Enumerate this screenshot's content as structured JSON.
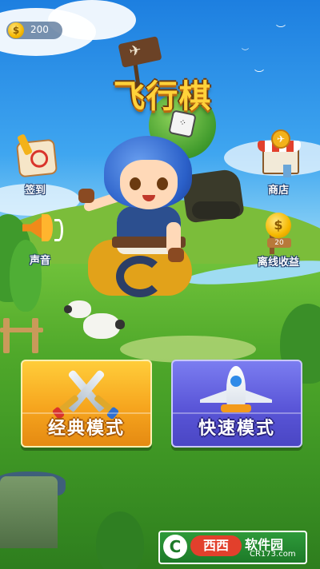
{
  "currency": {
    "coins": "200",
    "icon": "coin-icon"
  },
  "logo": {
    "title": "飞行棋"
  },
  "side_menu": {
    "checkin": {
      "label": "签到",
      "icon": "checkin-calendar-icon"
    },
    "sound": {
      "label": "声音",
      "icon": "speaker-horn-icon"
    },
    "shop": {
      "label": "商店",
      "icon": "shop-icon"
    },
    "offline": {
      "label": "离线收益",
      "icon": "offline-earnings-icon",
      "badge": "20"
    }
  },
  "modes": {
    "classic": {
      "label": "经典模式",
      "icon": "crossed-swords-icon"
    },
    "fast": {
      "label": "快速模式",
      "icon": "airplane-icon"
    }
  },
  "watermark": {
    "brand": "西西",
    "name": "软件园",
    "site": "CR173.com"
  },
  "colors": {
    "classic_button": "#f6a51e",
    "fast_button": "#5a56d8",
    "sky": "#2a8fe0",
    "grass": "#4fa82a"
  }
}
